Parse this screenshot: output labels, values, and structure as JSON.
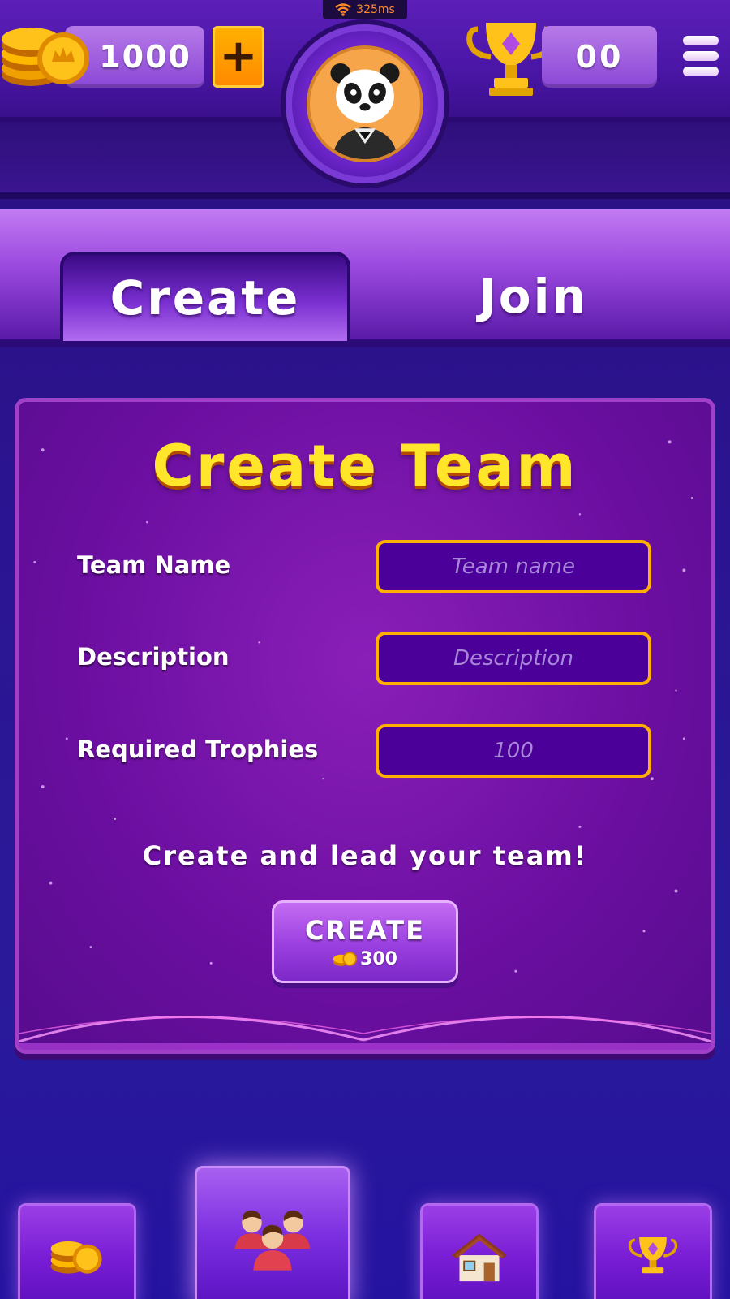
{
  "status": {
    "ping": "325ms"
  },
  "header": {
    "coins": "1000",
    "add_coins_label": "+",
    "trophies": "00"
  },
  "tabs": [
    {
      "label": "Create",
      "active": true
    },
    {
      "label": "Join",
      "active": false
    }
  ],
  "panel": {
    "title": "Create Team",
    "fields": [
      {
        "label": "Team Name",
        "placeholder": "Team name",
        "value": ""
      },
      {
        "label": "Description",
        "placeholder": "Description",
        "value": ""
      },
      {
        "label": "Required Trophies",
        "placeholder": "100",
        "value": ""
      }
    ],
    "tagline": "Create and lead your team!",
    "create_button": {
      "label": "CREATE",
      "cost": "300"
    }
  },
  "bottom_nav": [
    {
      "name": "shop",
      "icon": "coins-icon",
      "active": false
    },
    {
      "name": "team",
      "icon": "team-icon",
      "active": true
    },
    {
      "name": "home",
      "icon": "home-icon",
      "active": false
    },
    {
      "name": "leaderboard",
      "icon": "trophy-icon",
      "active": false
    }
  ],
  "colors": {
    "title_yellow": "#ffe62a",
    "input_border": "#ffb000",
    "panel_purple": "#6a0ea0"
  }
}
